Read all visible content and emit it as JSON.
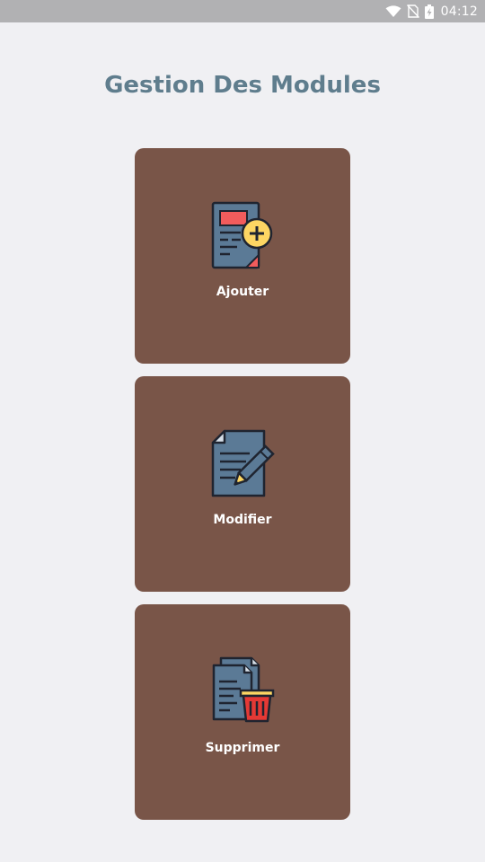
{
  "status_bar": {
    "time": "04:12",
    "icons": [
      "wifi-icon",
      "no-sim-icon",
      "battery-charging-icon"
    ]
  },
  "page": {
    "title": "Gestion Des Modules"
  },
  "actions": [
    {
      "label": "Ajouter",
      "icon": "document-add-icon"
    },
    {
      "label": "Modifier",
      "icon": "document-edit-icon"
    },
    {
      "label": "Supprimer",
      "icon": "document-delete-icon"
    }
  ],
  "colors": {
    "background": "#f0f0f3",
    "status_bar": "#b1b1b3",
    "title": "#5f7d8d",
    "card": "#795548",
    "card_text": "#ffffff",
    "icon_doc": "#5b7a96",
    "icon_red": "#f25c5c",
    "icon_yellow": "#fdd663"
  }
}
